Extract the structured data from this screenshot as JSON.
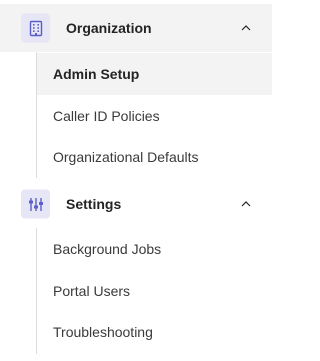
{
  "colors": {
    "icon_accent": "#5b5fc7",
    "icon_bg": "#e6e6f6",
    "active_bg": "#f3f3f3",
    "text": "#242424",
    "rail": "#dcdcdc"
  },
  "sections": [
    {
      "label": "Organization",
      "icon": "building-icon",
      "expanded": true,
      "items": [
        {
          "label": "Admin Setup",
          "selected": true
        },
        {
          "label": "Caller ID Policies",
          "selected": false
        },
        {
          "label": "Organizational Defaults",
          "selected": false
        }
      ]
    },
    {
      "label": "Settings",
      "icon": "sliders-icon",
      "expanded": true,
      "items": [
        {
          "label": "Background Jobs",
          "selected": false
        },
        {
          "label": "Portal Users",
          "selected": false
        },
        {
          "label": "Troubleshooting",
          "selected": false
        }
      ]
    }
  ]
}
